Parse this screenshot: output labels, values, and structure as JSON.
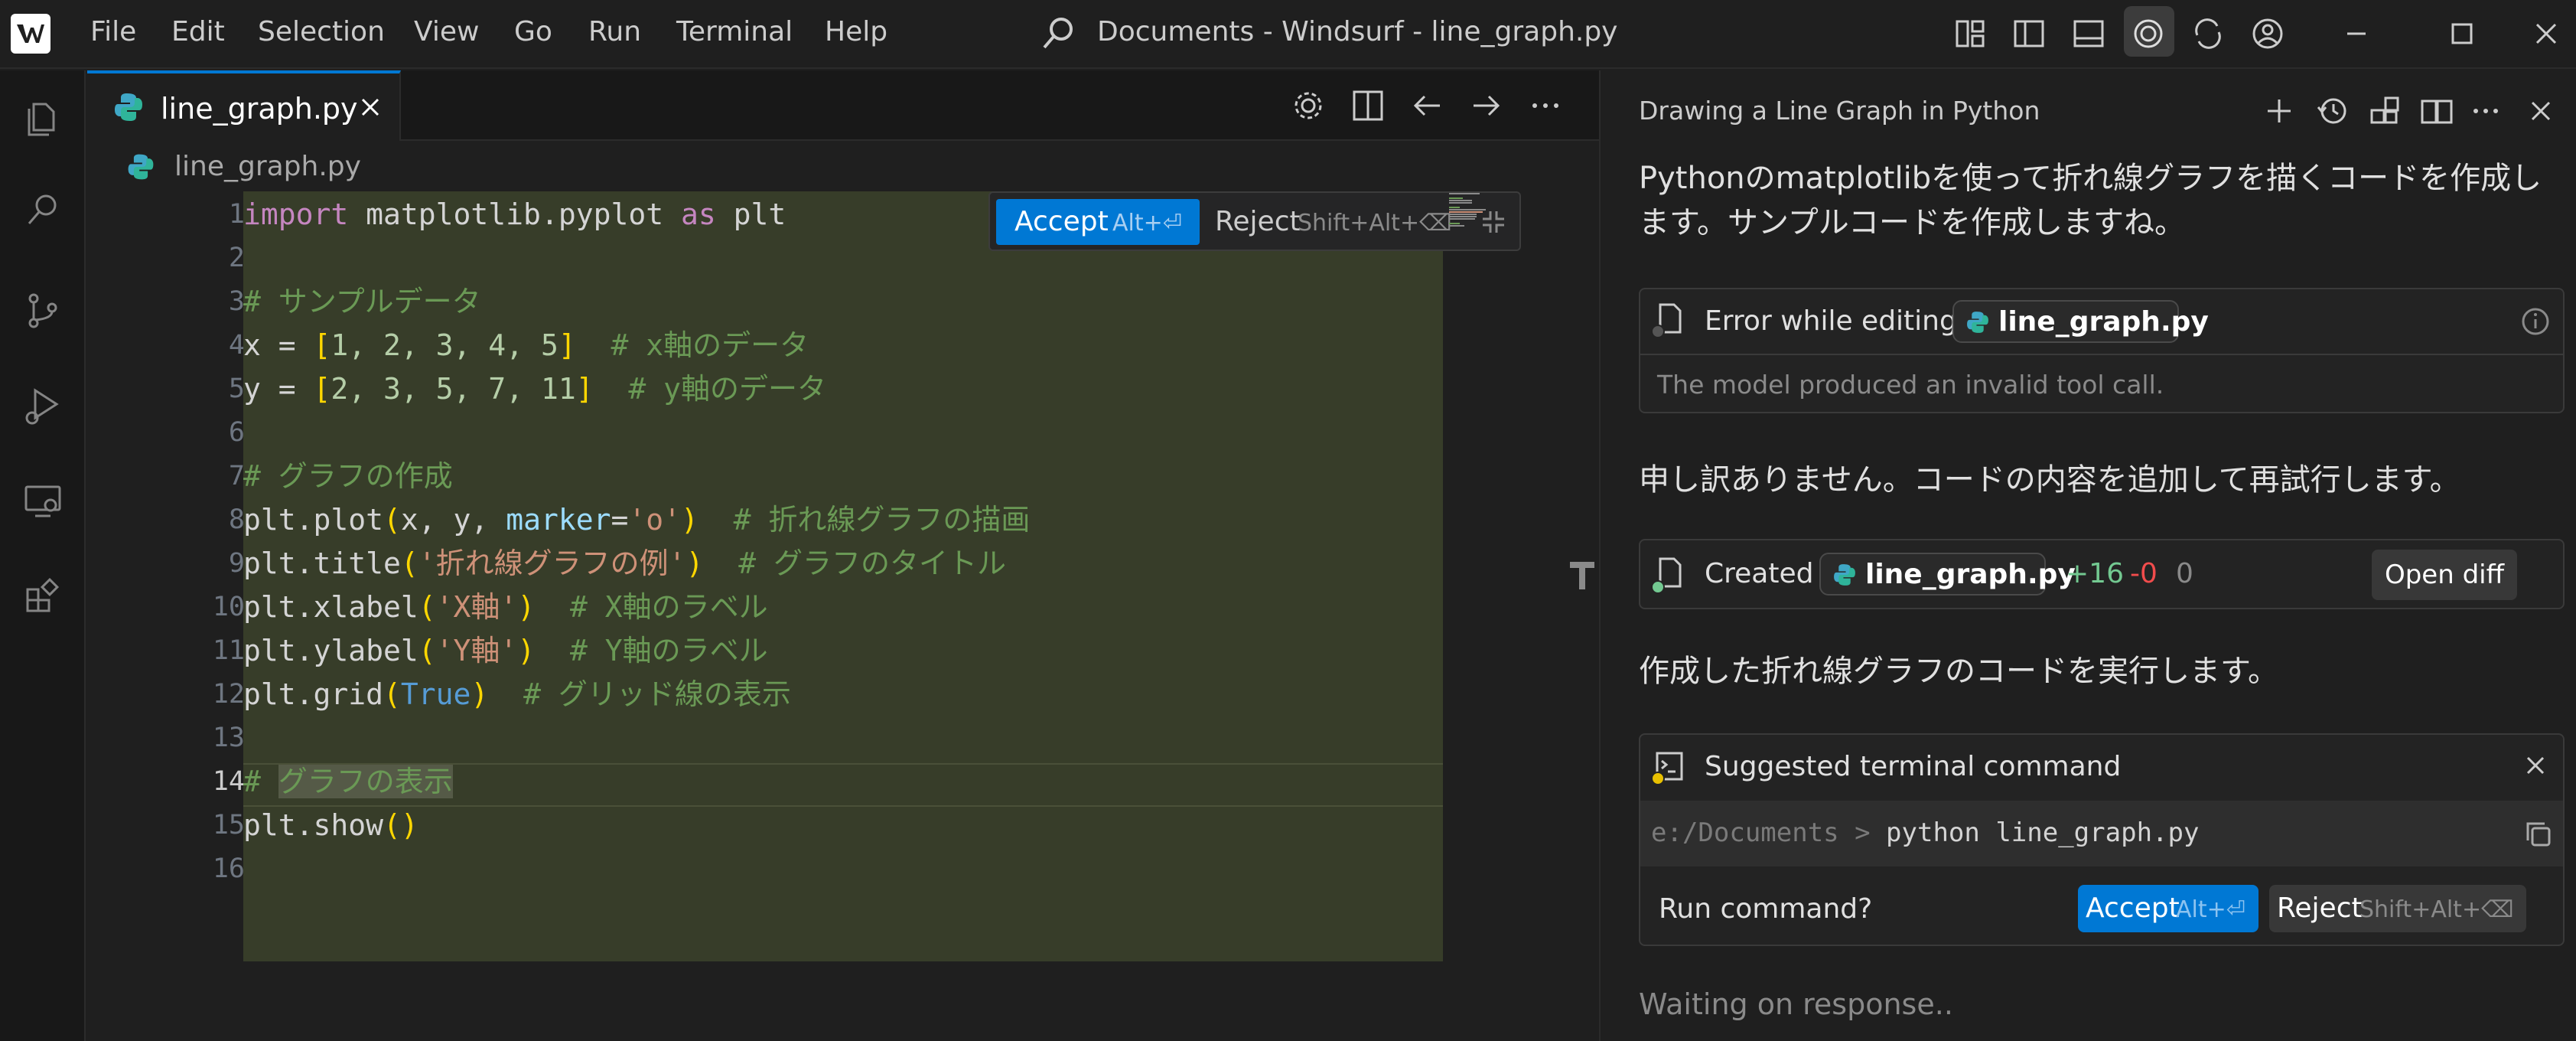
{
  "window": {
    "title": "Documents - Windsurf - line_graph.py",
    "menu": [
      "File",
      "Edit",
      "Selection",
      "View",
      "Go",
      "Run",
      "Terminal",
      "Help"
    ]
  },
  "editor": {
    "tab_label": "line_graph.py",
    "breadcrumb": "line_graph.py",
    "active_line": 14,
    "line_numbers": [
      "1",
      "2",
      "3",
      "4",
      "5",
      "6",
      "7",
      "8",
      "9",
      "10",
      "11",
      "12",
      "13",
      "14",
      "15",
      "16"
    ],
    "code": {
      "l1_import": "import",
      "l1_module": " matplotlib.pyplot ",
      "l1_as": "as",
      "l1_alias": " plt",
      "l3_comment": "# サンプルデータ",
      "l4_a": "x = ",
      "l4_open": "[",
      "l4_vals": "1, 2, 3, 4, 5",
      "l4_close": "]",
      "l4_comment": "  # x軸のデータ",
      "l5_a": "y = ",
      "l5_open": "[",
      "l5_vals": "2, 3, 5, 7, 11",
      "l5_close": "]",
      "l5_comment": "  # y軸のデータ",
      "l7_comment": "# グラフの作成",
      "l8_a": "plt.plot",
      "l8_open": "(",
      "l8_args": "x, y, ",
      "l8_param": "marker",
      "l8_eq": "=",
      "l8_str": "'o'",
      "l8_close": ")",
      "l8_comment": "  # 折れ線グラフの描画",
      "l9_a": "plt.title",
      "l9_open": "(",
      "l9_str": "'折れ線グラフの例'",
      "l9_close": ")",
      "l9_comment": "  # グラフのタイトル",
      "l10_a": "plt.xlabel",
      "l10_open": "(",
      "l10_str": "'X軸'",
      "l10_close": ")",
      "l10_comment": "  # X軸のラベル",
      "l11_a": "plt.ylabel",
      "l11_open": "(",
      "l11_str": "'Y軸'",
      "l11_close": ")",
      "l11_comment": "  # Y軸のラベル",
      "l12_a": "plt.grid",
      "l12_open": "(",
      "l12_bool": "True",
      "l12_close": ")",
      "l12_comment": "  # グリッド線の表示",
      "l14_hash": "# ",
      "l14_text": "グラフの表示",
      "l15_a": "plt.show",
      "l15_parens": "()"
    },
    "diff_toolbar": {
      "accept_label": "Accept",
      "accept_kbd": "Alt+⏎",
      "reject_label": "Reject",
      "reject_kbd": "Shift+Alt+⌫"
    }
  },
  "chat": {
    "title": "Drawing a Line Graph in Python",
    "msg1": "Pythonのmatplotlibを使って折れ線グラフを描くコードを作成します。サンプルコードを作成しますね。",
    "error_card": {
      "label": "Error while editing",
      "file": "line_graph.py",
      "detail": "The model produced an invalid tool call."
    },
    "msg2": "申し訳ありません。コードの内容を追加して再試行します。",
    "created_card": {
      "label": "Created",
      "file": "line_graph.py",
      "added": "+16",
      "removed": "-0",
      "other": "0",
      "open_diff": "Open diff"
    },
    "msg3": "作成した折れ線グラフのコードを実行します。",
    "terminal_card": {
      "title": "Suggested terminal command",
      "path": "e:/Documents > ",
      "command": "python line_graph.py",
      "question": "Run command?",
      "accept_label": "Accept",
      "accept_kbd": "Alt+⏎",
      "reject_label": "Reject",
      "reject_kbd": "Shift+Alt+⌫"
    },
    "status": "Waiting on response.."
  },
  "colors": {
    "accent": "#0078d4",
    "diff_added_bg": "#373d29",
    "added": "#73c991",
    "removed": "#f14c4c"
  },
  "icons": {
    "activity_bar": [
      "explorer-icon",
      "search-icon",
      "source-control-icon",
      "run-debug-icon",
      "remote-explorer-icon",
      "extensions-icon"
    ]
  }
}
